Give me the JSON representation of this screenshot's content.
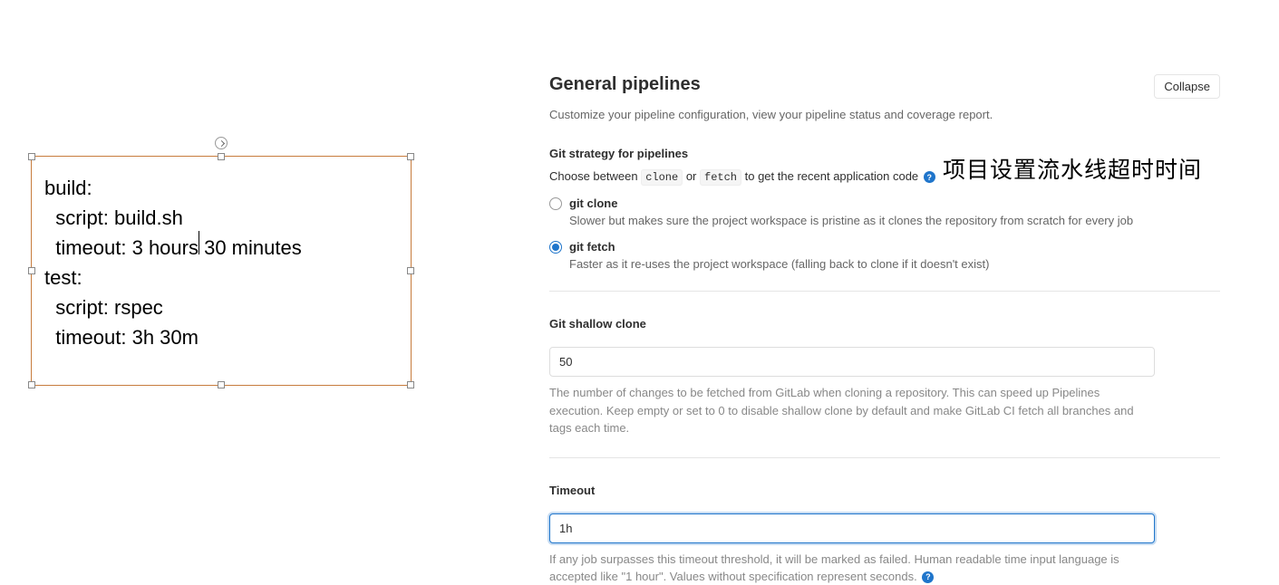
{
  "editor": {
    "lines": [
      "build:",
      "  script: build.sh",
      "  timeout: 3 hours 30 minutes",
      "",
      "test:",
      "  script: rspec",
      "  timeout: 3h 30m"
    ]
  },
  "panel": {
    "title": "General pipelines",
    "subtitle": "Customize your pipeline configuration, view your pipeline status and coverage report.",
    "collapse_label": "Collapse"
  },
  "annotation": "项目设置流水线超时时间",
  "git_strategy": {
    "title": "Git strategy for pipelines",
    "desc_prefix": "Choose between ",
    "code1": "clone",
    "desc_mid": " or ",
    "code2": "fetch",
    "desc_suffix": " to get the recent application code ",
    "options": [
      {
        "label": "git clone",
        "help": "Slower but makes sure the project workspace is pristine as it clones the repository from scratch for every job",
        "checked": false
      },
      {
        "label": "git fetch",
        "help": "Faster as it re-uses the project workspace (falling back to clone if it doesn't exist)",
        "checked": true
      }
    ]
  },
  "shallow": {
    "title": "Git shallow clone",
    "value": "50",
    "hint": "The number of changes to be fetched from GitLab when cloning a repository. This can speed up Pipelines execution. Keep empty or set to 0 to disable shallow clone by default and make GitLab CI fetch all branches and tags each time."
  },
  "timeout": {
    "title": "Timeout",
    "value": "1h",
    "hint_prefix": "If any job surpasses this timeout threshold, it will be marked as failed. Human readable time input language is accepted like \"1 hour\". Values without specification represent seconds. "
  }
}
